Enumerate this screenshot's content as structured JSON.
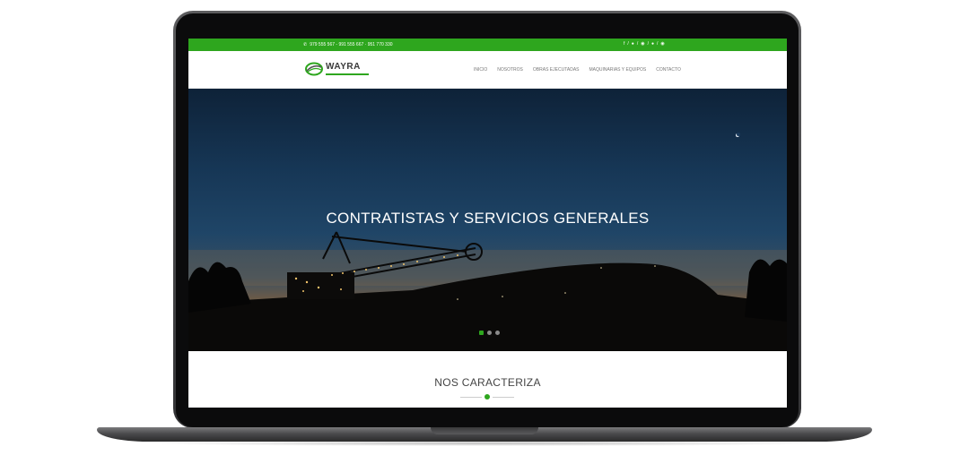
{
  "topbar": {
    "phones": "979 555 567 - 991 555 667 · 951 770 330",
    "social_icons": [
      "facebook-icon",
      "twitter-icon",
      "instagram-icon",
      "whatsapp-icon",
      "email-icon"
    ]
  },
  "brand": {
    "name": "WAYRA",
    "accent_color": "#2ea61e"
  },
  "nav": {
    "items": [
      "INICIO",
      "NOSOTROS",
      "OBRAS EJECUTADAS",
      "MAQUINARIAS Y EQUIPOS",
      "CONTACTO"
    ]
  },
  "hero": {
    "title": "CONTRATISTAS Y SERVICIOS GENERALES",
    "slide_count": 3,
    "active_slide": 1
  },
  "section": {
    "title": "NOS CARACTERIZA"
  }
}
